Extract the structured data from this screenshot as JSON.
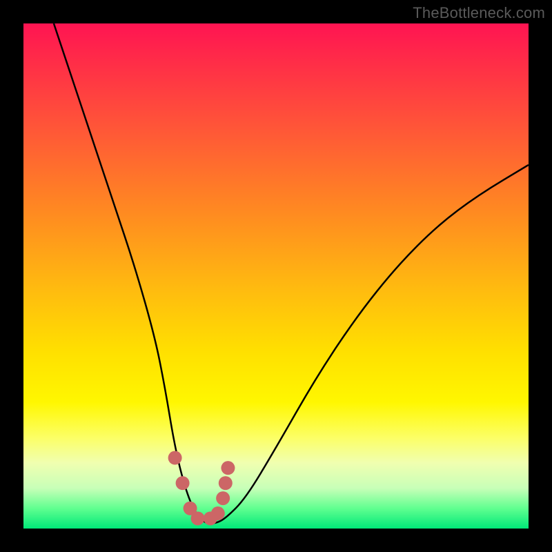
{
  "watermark": "TheBottleneck.com",
  "chart_data": {
    "type": "line",
    "title": "",
    "xlabel": "",
    "ylabel": "",
    "xlim": [
      0,
      100
    ],
    "ylim": [
      0,
      100
    ],
    "series": [
      {
        "name": "bottleneck-curve",
        "x": [
          6,
          10,
          14,
          18,
          22,
          26,
          28,
          30,
          32,
          34,
          36,
          38,
          40,
          44,
          50,
          58,
          66,
          74,
          82,
          90,
          100
        ],
        "values": [
          100,
          88,
          76,
          64,
          52,
          38,
          28,
          16,
          8,
          3,
          1,
          1,
          2,
          6,
          16,
          30,
          42,
          52,
          60,
          66,
          72
        ]
      }
    ],
    "markers": {
      "name": "highlight-points",
      "color": "#cc6666",
      "x": [
        30,
        31.5,
        33,
        34.5,
        37,
        38.5,
        39.5,
        40,
        40.5
      ],
      "values": [
        14,
        9,
        4,
        2,
        2,
        3,
        6,
        9,
        12
      ]
    },
    "gradient_background": {
      "top_color": "#ff1452",
      "bottom_color": "#00e878",
      "description": "red-to-green vertical gradient representing bottleneck severity"
    }
  }
}
